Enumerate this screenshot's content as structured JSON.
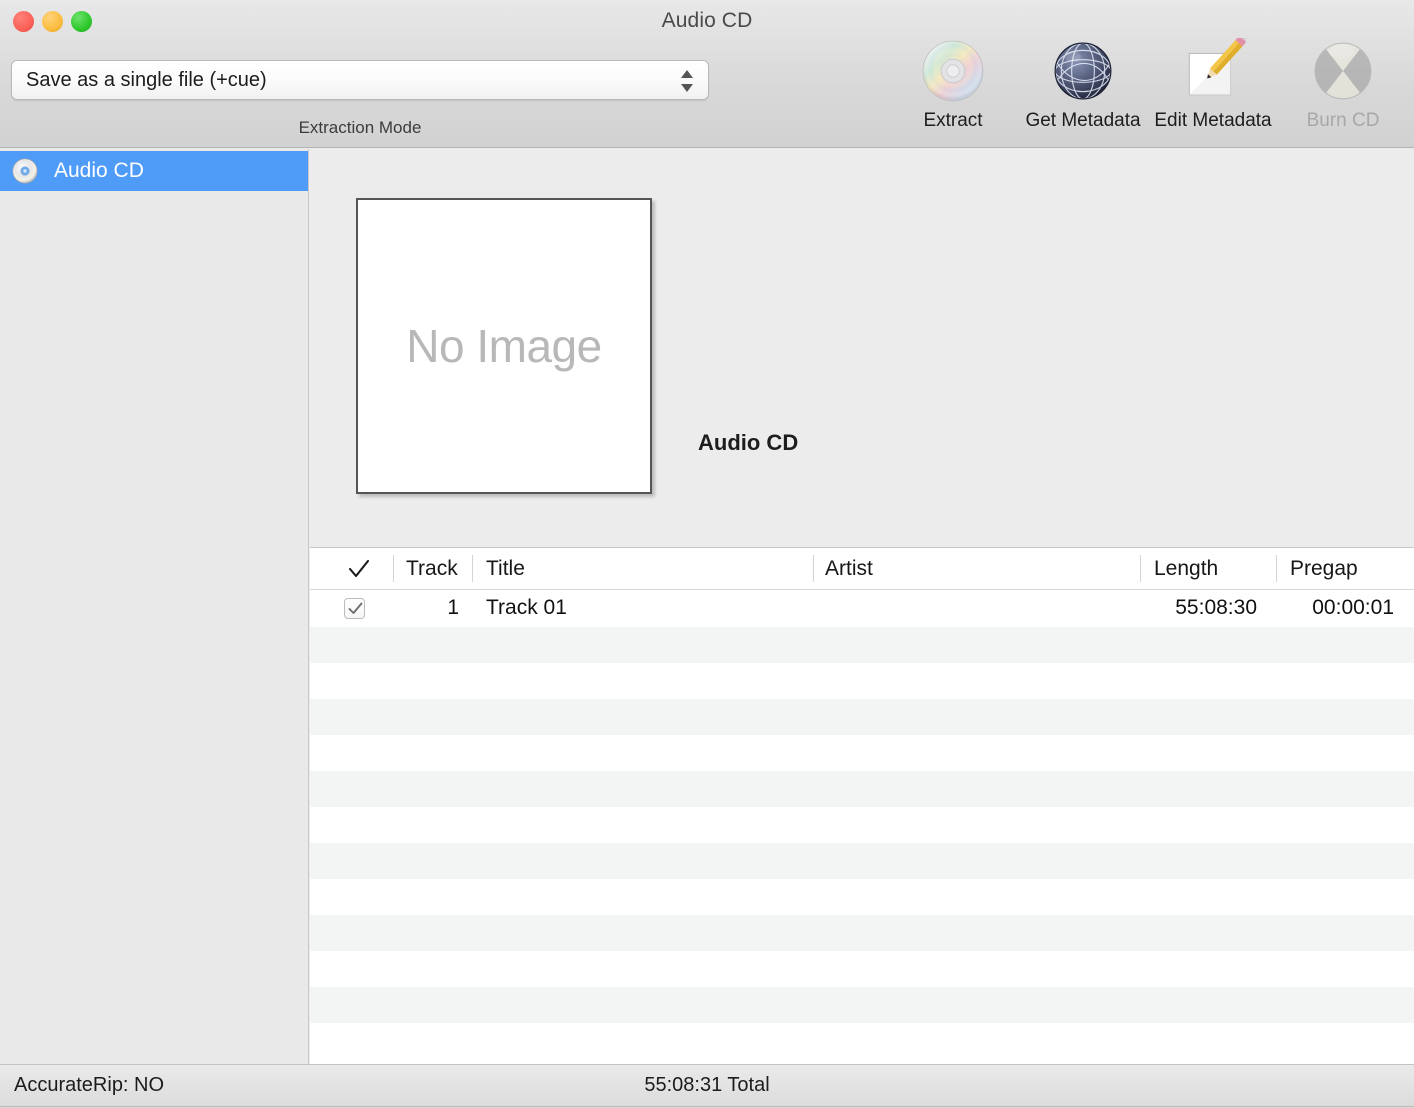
{
  "window": {
    "title": "Audio CD",
    "traffic_lights": [
      {
        "name": "close",
        "color": "#fa6158"
      },
      {
        "name": "minimize",
        "color": "#fcbc40"
      },
      {
        "name": "zoom",
        "color": "#2ec82c"
      }
    ]
  },
  "toolbar": {
    "extraction_mode": {
      "value": "Save as a single file (+cue)",
      "caption": "Extraction Mode",
      "icon": "chevron-updown-icon"
    },
    "items": [
      {
        "label": "Extract",
        "icon": "compact-disc-icon",
        "enabled": true
      },
      {
        "label": "Get Metadata",
        "icon": "globe-network-icon",
        "enabled": true
      },
      {
        "label": "Edit Metadata",
        "icon": "pencil-note-icon",
        "enabled": true
      },
      {
        "label": "Burn CD",
        "icon": "burn-disc-icon",
        "enabled": false
      }
    ]
  },
  "sidebar": {
    "items": [
      {
        "label": "Audio CD",
        "icon": "compact-disc-icon",
        "selected": true
      }
    ],
    "selection_color": "#4f9bf8"
  },
  "album": {
    "cover_placeholder": "No Image",
    "title": "Audio CD"
  },
  "table": {
    "columns": [
      {
        "key": "check",
        "label": "✓",
        "icon": "checkmark-icon"
      },
      {
        "key": "track",
        "label": "Track"
      },
      {
        "key": "title",
        "label": "Title"
      },
      {
        "key": "artist",
        "label": "Artist"
      },
      {
        "key": "length",
        "label": "Length"
      },
      {
        "key": "pregap",
        "label": "Pregap"
      }
    ],
    "rows": [
      {
        "checked": true,
        "track": "1",
        "title": "Track 01",
        "artist": "",
        "length": "55:08:30",
        "pregap": "00:00:01"
      }
    ],
    "empty_row_count": 12
  },
  "statusbar": {
    "accuraterip_label": "AccurateRip:",
    "accuraterip_value": "NO",
    "accuraterip_text": "AccurateRip:  NO",
    "total_text": "55:08:31 Total"
  }
}
